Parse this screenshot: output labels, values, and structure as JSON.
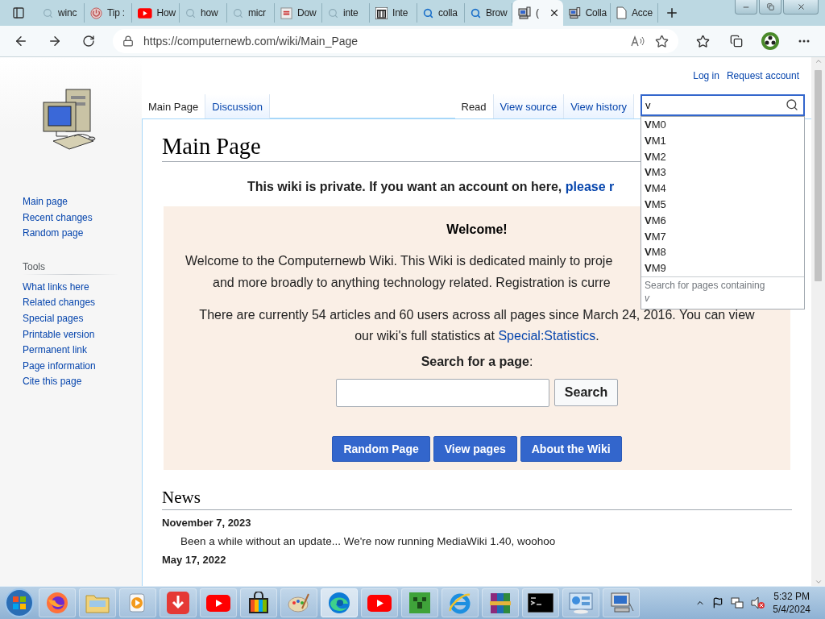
{
  "browser": {
    "tabs": [
      {
        "title": "winc",
        "selected": false
      },
      {
        "title": "Tip :",
        "selected": false
      },
      {
        "title": "How",
        "selected": false
      },
      {
        "title": "how",
        "selected": false
      },
      {
        "title": "micr",
        "selected": false
      },
      {
        "title": "Dow",
        "selected": false
      },
      {
        "title": "inte",
        "selected": false
      },
      {
        "title": "Inte",
        "selected": false
      },
      {
        "title": "colla",
        "selected": false
      },
      {
        "title": "Brow",
        "selected": false
      },
      {
        "title": "(",
        "selected": true
      },
      {
        "title": "Colla",
        "selected": false
      },
      {
        "title": "Acce",
        "selected": false
      }
    ],
    "url": "https://computernewb.com/wiki/Main_Page"
  },
  "wiki": {
    "personal": [
      "Log in",
      "Request account"
    ],
    "left_tabs": [
      {
        "label": "Main Page",
        "selected": true
      },
      {
        "label": "Discussion",
        "selected": false
      }
    ],
    "right_tabs": [
      {
        "label": "Read",
        "selected": true
      },
      {
        "label": "View source",
        "selected": false
      },
      {
        "label": "View history",
        "selected": false
      }
    ],
    "search": {
      "value": "v"
    },
    "suggestions": [
      "**V**M0",
      "**V**M1",
      "**V**M2",
      "**V**M3",
      "**V**M4",
      "**V**M5",
      "**V**M6",
      "**V**M7",
      "**V**M8",
      "**V**M9"
    ],
    "search_containing": {
      "label": "Search for pages containing",
      "term": "v"
    },
    "sidebar": {
      "navigation": [
        "Main page",
        "Recent changes",
        "Random page"
      ],
      "tools_heading": "Tools",
      "tools": [
        "What links here",
        "Related changes",
        "Special pages",
        "Printable version",
        "Permanent link",
        "Page information",
        "Cite this page"
      ]
    },
    "title": "Main Page",
    "notice": {
      "text": "This wiki is private. If you want an account on here,",
      "link": "please r"
    },
    "welcome": {
      "heading": "Welcome!",
      "lines": [
        "Welcome to the Computernewb Wiki. This Wiki is dedicated mainly to proje",
        "and more broadly to anything technology related. Registration is curre"
      ],
      "stats_text": "There are currently 54 articles and 60 users across all pages since March 24, 2016. You can view our wiki's full statistics at",
      "stats_link": "Special:Statistics",
      "stats_end": ".",
      "search_label": "**Search for a page**:",
      "search_button": "Search",
      "buttons": [
        "Random Page",
        "View pages",
        "About the Wiki"
      ]
    },
    "news": {
      "heading": "News",
      "items": [
        {
          "date": "November 7, 2023",
          "text": "Been a while without an update... We're now running MediaWiki 1.40, woohoo"
        },
        {
          "date": "May 17, 2022"
        }
      ]
    }
  },
  "taskbar": {
    "apps": [
      {
        "kind": "firefox",
        "selected": false
      },
      {
        "kind": "folder",
        "selected": false
      },
      {
        "kind": "player",
        "selected": false
      },
      {
        "kind": "download",
        "selected": false
      },
      {
        "kind": "youtube",
        "selected": false
      },
      {
        "kind": "store",
        "selected": false
      },
      {
        "kind": "paint",
        "selected": false
      },
      {
        "kind": "edge",
        "selected": true
      },
      {
        "kind": "youtube",
        "selected": false
      },
      {
        "kind": "block",
        "selected": false
      },
      {
        "kind": "ie",
        "selected": false
      },
      {
        "kind": "archive",
        "selected": false
      },
      {
        "kind": "terminal",
        "selected": false
      },
      {
        "kind": "panel",
        "selected": false
      },
      {
        "kind": "network",
        "selected": false
      }
    ],
    "time": "5:32 PM",
    "date": "5/4/2024"
  }
}
